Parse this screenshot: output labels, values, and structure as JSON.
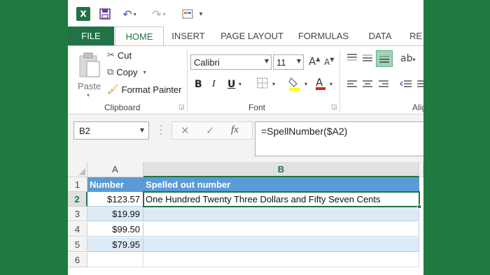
{
  "colors": {
    "accent": "#217346",
    "header_fill": "#5b9bd5",
    "band_fill": "#ddebf7",
    "background": "#1f7a3f"
  },
  "qat": {
    "icons": [
      "excel-icon",
      "save-icon",
      "undo-icon",
      "redo-icon",
      "customize-icon"
    ]
  },
  "tabs": [
    "FILE",
    "HOME",
    "INSERT",
    "PAGE LAYOUT",
    "FORMULAS",
    "DATA",
    "RE"
  ],
  "ribbon": {
    "clipboard": {
      "paste": "Paste",
      "cut": "Cut",
      "copy": "Copy",
      "format_painter": "Format Painter",
      "label": "Clipboard"
    },
    "font": {
      "name": "Calibri",
      "size": "11",
      "bold": "B",
      "italic": "I",
      "underline": "U",
      "label": "Font"
    },
    "alignment": {
      "label": "Alig"
    }
  },
  "formula_bar": {
    "name_box": "B2",
    "fx": "fx",
    "formula": "=SpellNumber($A2)"
  },
  "grid": {
    "columns": [
      "A",
      "B"
    ],
    "rows": [
      "1",
      "2",
      "3",
      "4",
      "5",
      "6"
    ],
    "header": {
      "a": "Number",
      "b": "Spelled out number"
    },
    "data": [
      {
        "a": "$123.57",
        "b": "One Hundred Twenty Three Dollars and Fifty Seven Cents"
      },
      {
        "a": "$19.99",
        "b": ""
      },
      {
        "a": "$99.50",
        "b": ""
      },
      {
        "a": "$79.95",
        "b": ""
      }
    ]
  }
}
